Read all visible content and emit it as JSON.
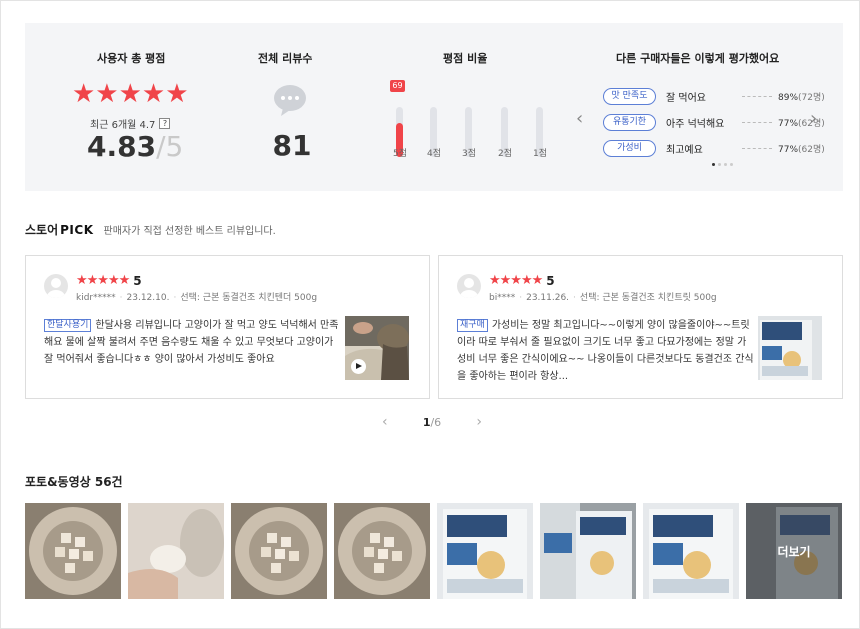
{
  "summary": {
    "user_rating_title": "사용자 총 평점",
    "stars": "★★★★★",
    "recent_label": "최근 6개월 4.7",
    "help": "?",
    "average": "4.83",
    "average_max": "5",
    "total_reviews_title": "전체 리뷰수",
    "total_reviews": "81",
    "ratio_title": "평점 비율",
    "ratio": [
      {
        "label": "5점",
        "percent": 69
      },
      {
        "label": "4점",
        "percent": 0
      },
      {
        "label": "3점",
        "percent": 0
      },
      {
        "label": "2점",
        "percent": 0
      },
      {
        "label": "1점",
        "percent": 0
      }
    ],
    "top_badge": "69",
    "others_title": "다른 구매자들은 이렇게 평가했어요",
    "evaluations": [
      {
        "chip": "맛 만족도",
        "text": "잘 먹어요",
        "pct": "89%",
        "count": "(72명)"
      },
      {
        "chip": "유통기한",
        "text": "아주 넉넉해요",
        "pct": "77%",
        "count": "(62명)"
      },
      {
        "chip": "가성비",
        "text": "최고예요",
        "pct": "77%",
        "count": "(62명)"
      }
    ],
    "prev_icon": "chevron-left-icon",
    "next_icon": "chevron-right-icon"
  },
  "store_pick": {
    "title_a": "스토어",
    "title_b": "PICK",
    "desc": "판매자가 직접 선정한 베스트 리뷰입니다.",
    "reviews": [
      {
        "stars": "★★★★★",
        "score": "5",
        "user": "kidr*****",
        "date": "23.12.10.",
        "option": "선택: 근본 동결건조 치킨텐더 500g",
        "tag": "한달사용기",
        "text": "한달사용 리뷰입니다 고양이가 잘 먹고 양도 넉넉해서 만족해요 물에 살짝 불려서 주면 음수량도 채울 수 있고 무엇보다 고양이가 잘 먹어줘서 좋습니다ㅎㅎ 양이 많아서 가성비도 좋아요"
      },
      {
        "stars": "★★★★★",
        "score": "5",
        "user": "bi****",
        "date": "23.11.26.",
        "option": "선택: 근본 동결건조 치킨트릿 500g",
        "tag": "재구매",
        "text": "가성비는 정말 최고입니다~~이렇게 양이 많을줄이야~~트릿이라 따로 부숴서 줄 필요없이 크기도 너무 좋고 다묘가정에는 정말 가성비 너무 좋은 간식이에요~~ 나옹이들이 다른것보다도 동결건조 간식을 좋아하는 편이라 항상..."
      }
    ],
    "page_current": "1",
    "page_total": "/6"
  },
  "photos": {
    "title": "포토&동영상 56건",
    "more": "더보기"
  }
}
